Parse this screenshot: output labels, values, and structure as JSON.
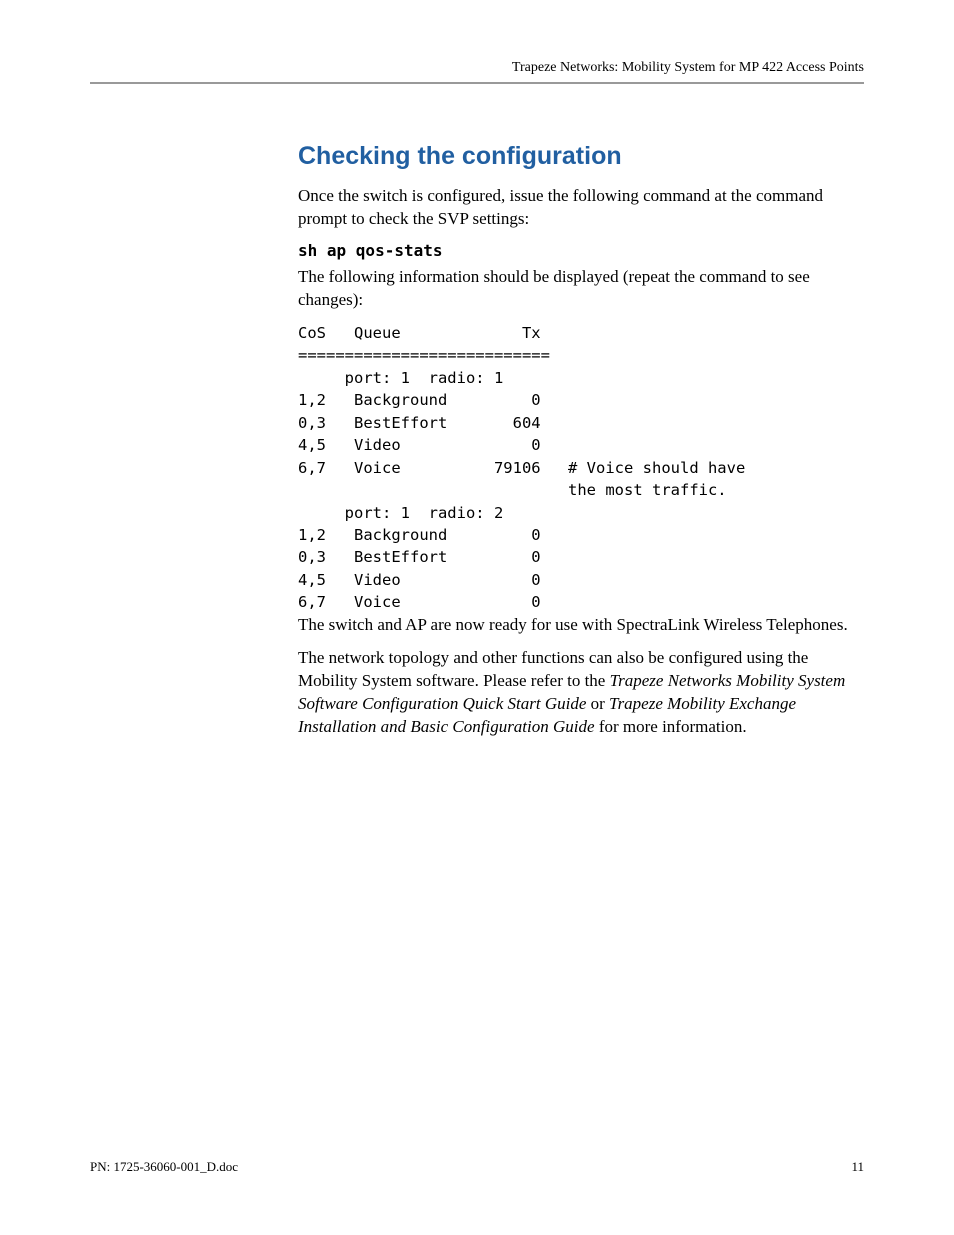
{
  "header": {
    "running_title": "Trapeze Networks: Mobility System for MP 422 Access Points"
  },
  "section": {
    "title": "Checking the configuration",
    "intro": "Once the switch is configured, issue the following command at the command prompt to check the SVP settings:",
    "command": "sh ap qos-stats",
    "followup": "The following information should be displayed (repeat the command to see changes):",
    "code": {
      "head_line": "CoS   Queue             Tx",
      "sep_line": "===========================",
      "groups": [
        {
          "header": "     port: 1  radio: 1",
          "rows": [
            {
              "line": "1,2   Background         0",
              "annot": ""
            },
            {
              "line": "0,3   BestEffort       604",
              "annot": ""
            },
            {
              "line": "4,5   Video              0",
              "annot": ""
            },
            {
              "line": "6,7   Voice          79106",
              "annot": "# Voice should have\nthe most traffic."
            }
          ]
        },
        {
          "header": "     port: 1  radio: 2",
          "rows": [
            {
              "line": "1,2   Background         0",
              "annot": ""
            },
            {
              "line": "0,3   BestEffort         0",
              "annot": ""
            },
            {
              "line": "4,5   Video              0",
              "annot": ""
            },
            {
              "line": "6,7   Voice              0",
              "annot": ""
            }
          ]
        }
      ]
    },
    "after1": "The switch and AP are now ready for use with SpectraLink Wireless Telephones.",
    "after2_pre": "The network topology and other functions can also be configured using the Mobility System software. Please refer to the ",
    "after2_it1": "Trapeze Networks Mobility System Software Configuration Quick Start Guide",
    "after2_mid": " or ",
    "after2_it2": "Trapeze Mobility Exchange Installation and Basic Configuration Guide",
    "after2_post": " for more information."
  },
  "footer": {
    "left": "PN: 1725-36060-001_D.doc",
    "right": "11"
  }
}
